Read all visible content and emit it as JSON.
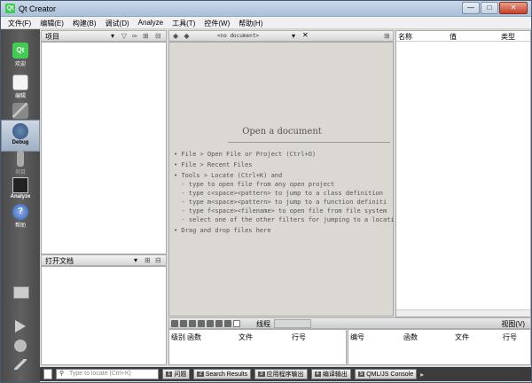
{
  "window": {
    "title": "Qt Creator",
    "minimize": "—",
    "maximize": "□",
    "close": "✕"
  },
  "menu": [
    "文件(F)",
    "编辑(E)",
    "构建(B)",
    "调试(D)",
    "Analyze",
    "工具(T)",
    "控件(W)",
    "帮助(H)"
  ],
  "modes": [
    {
      "label": "欢迎",
      "icon": "qt-logo-icon"
    },
    {
      "label": "编辑",
      "icon": "edit-document-icon"
    },
    {
      "label": "设计",
      "icon": "design-pen-icon"
    },
    {
      "label": "Debug",
      "icon": "debug-bug-icon"
    },
    {
      "label": "项目",
      "icon": "projects-wrench-icon"
    },
    {
      "label": "Analyze",
      "icon": "analyze-monitor-icon"
    },
    {
      "label": "帮助",
      "icon": "help-icon"
    }
  ],
  "projects_pane": {
    "title": "项目"
  },
  "open_docs_pane": {
    "title": "打开文档"
  },
  "editor": {
    "doc_combo": "<no document>",
    "heading": "Open a document",
    "lines": [
      "• File > Open File or Project (Ctrl+O)",
      "• File > Recent Files",
      "• Tools > Locate (Ctrl+K) and",
      "  - type to open file from any open project",
      "  - type c<space><pattern> to jump to a class definition",
      "  - type m<space><pattern> to jump to a function definiti",
      "  - type f<space><filename> to open file from file system",
      "  - select one of the other filters for jumping to a locati",
      "• Drag and drop files here"
    ]
  },
  "watch": {
    "columns": [
      "名称",
      "值",
      "类型"
    ]
  },
  "threads": {
    "label": "线程"
  },
  "stack": {
    "columns": [
      "级别",
      "函数",
      "文件",
      "行号"
    ]
  },
  "breakpoints": {
    "columns": [
      "编号",
      "函数",
      "文件",
      "行号"
    ]
  },
  "view_label": "视图(V)",
  "statusbar": {
    "locate_placeholder": "Type to locate (Ctrl+K)",
    "tabs": [
      {
        "num": "1",
        "label": "问题"
      },
      {
        "num": "2",
        "label": "Search Results"
      },
      {
        "num": "3",
        "label": "应用程序输出"
      },
      {
        "num": "4",
        "label": "编译输出"
      },
      {
        "num": "5",
        "label": "QML/JS Console"
      }
    ]
  },
  "colors": {
    "modebar": "#555555",
    "editor_bg": "#dbd8d3",
    "accent_green": "#41cd52"
  }
}
